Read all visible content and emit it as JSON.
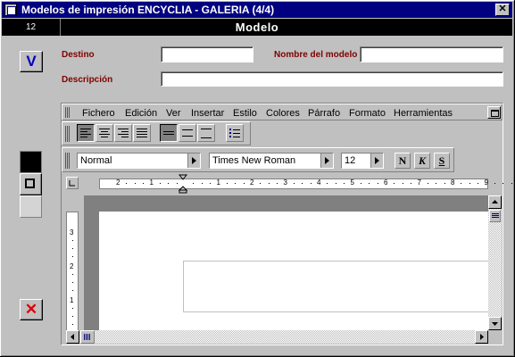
{
  "window": {
    "title": "Modelos de impresión ENCYCLIA - GALERIA (4/4)",
    "close_glyph": "✕"
  },
  "header": {
    "record_number": "12",
    "title": "Modelo"
  },
  "form": {
    "destino_label": "Destino",
    "destino_value": "",
    "nombre_label": "Nombre del modelo",
    "nombre_value": "",
    "descripcion_label": "Descripción",
    "descripcion_value": ""
  },
  "side_buttons": {
    "accept_glyph": "V",
    "cancel_glyph": "✕",
    "accept_color": "#0000c0",
    "cancel_color": "#e00000"
  },
  "editor": {
    "menu": [
      "Fichero",
      "Edición",
      "Ver",
      "Insertar",
      "Estilo",
      "Colores",
      "Párrafo",
      "Formato",
      "Herramientas"
    ],
    "format_bar": {
      "style": "Normal",
      "font": "Times New Roman",
      "size": "12",
      "bold": "N",
      "italic": "K",
      "underline": "S"
    },
    "ruler_h_labels": [
      "2",
      "1",
      "",
      "1",
      "2",
      "3",
      "4",
      "5",
      "6",
      "7",
      "8",
      "9"
    ],
    "ruler_v_labels": [
      "3",
      "2",
      "1"
    ]
  },
  "colors": {
    "title_bar": "#000080",
    "header_bar": "#000000",
    "label": "#800000"
  }
}
